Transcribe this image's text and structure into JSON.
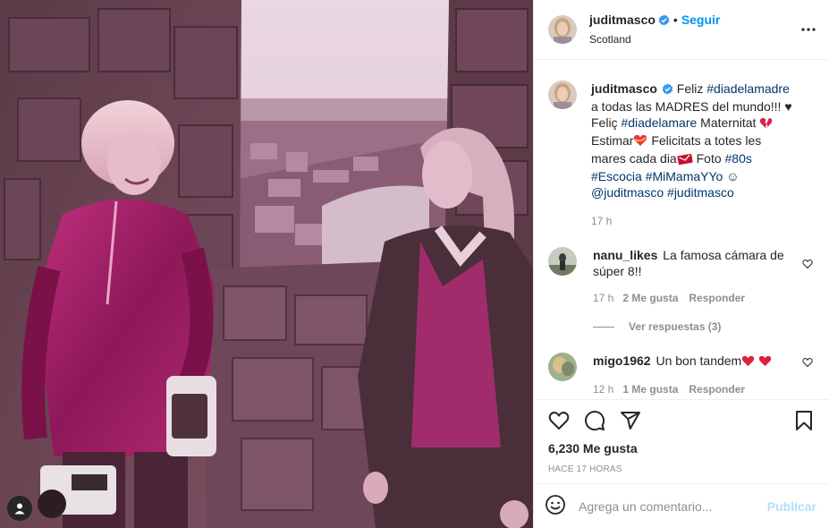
{
  "post": {
    "username": "juditmasco",
    "follow_label": "Seguir",
    "location": "Scotland",
    "more_icon": "more-horizontal-icon"
  },
  "caption": {
    "username": "juditmasco",
    "parts": {
      "t1": "Feliz ",
      "h1": "#diadelamadre",
      "t2": " a todas las MADRES del mundo!!! ♥ Feliç ",
      "h2": "#diadelamare",
      "t3": " Maternitat ",
      "t4": " Estimar",
      "t5": " Felicitats a totes les mares cada dia",
      "t6": " Foto ",
      "h3": "#80s",
      "h4": "#Escocia",
      "h5": "#MiMamaYYo",
      "t7": " ☺ ",
      "h6": "@juditmasco",
      "h7": "#juditmasco"
    },
    "time": "17 h"
  },
  "comments": [
    {
      "username": "nanu_likes",
      "text": "La famosa cámara de súper 8!!",
      "time": "17 h",
      "likes": "2 Me gusta",
      "reply_label": "Responder",
      "view_replies": "Ver respuestas (3)"
    },
    {
      "username": "migo1962",
      "text": "Un bon tandem",
      "time": "12 h",
      "likes": "1 Me gusta",
      "reply_label": "Responder"
    }
  ],
  "actions": {
    "icons": [
      "heart-icon",
      "comment-icon",
      "share-icon",
      "bookmark-icon"
    ],
    "likes": "6,230 Me gusta",
    "time_ago": "HACE 17 HORAS"
  },
  "add_comment": {
    "placeholder": "Agrega un comentario...",
    "publish_label": "Publicar"
  },
  "colors": {
    "accent": "#0095f6",
    "hashtag": "#00376b",
    "muted": "#8e8e8e",
    "publish_disabled": "#b2dffc"
  }
}
